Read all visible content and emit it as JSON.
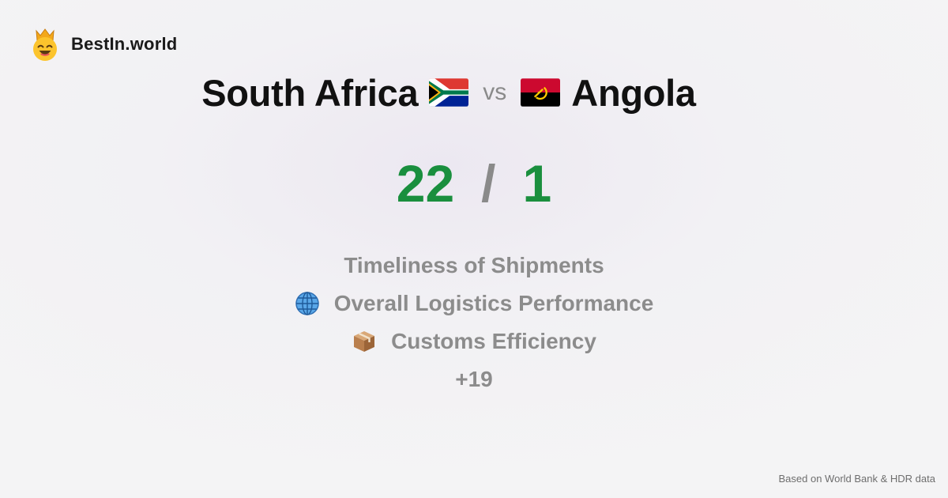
{
  "brand": {
    "name": "BestIn.world",
    "icon": "crown-smiley-icon"
  },
  "comparison": {
    "country_a": {
      "name": "South Africa",
      "flag_icon": "south-africa-flag-icon"
    },
    "vs_label": "vs",
    "country_b": {
      "name": "Angola",
      "flag_icon": "angola-flag-icon"
    }
  },
  "score": {
    "a": "22",
    "separator": "/",
    "b": "1",
    "color": "#1a8f3e"
  },
  "categories": [
    {
      "label": "Timeliness of Shipments",
      "icon": ""
    },
    {
      "label": "Overall Logistics Performance",
      "icon": "globe-icon"
    },
    {
      "label": "Customs Efficiency",
      "icon": "package-box-icon"
    }
  ],
  "more": "+19",
  "footer": "Based on World Bank & HDR data"
}
